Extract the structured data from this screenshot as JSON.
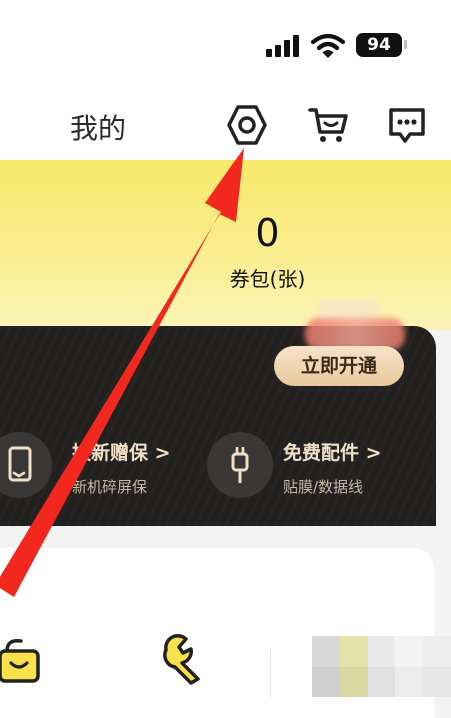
{
  "status_bar": {
    "battery": "94"
  },
  "nav": {
    "title": "我的",
    "icons": [
      "settings-hexagon-icon",
      "cart-icon",
      "message-icon"
    ]
  },
  "coupon": {
    "count": "0",
    "label": "券包(张)"
  },
  "vip": {
    "open_button": "立即开通",
    "benefits": [
      {
        "title": "换新赠保 >",
        "subtitle": "新机碎屏保",
        "icon": "phone-shield-icon"
      },
      {
        "title": "免费配件 >",
        "subtitle": "贴膜/数据线",
        "icon": "usb-cable-icon"
      }
    ]
  },
  "bottom": {
    "icons": [
      "shopping-bag-icon",
      "wrench-icon"
    ]
  },
  "colors": {
    "accent_yellow": "#f8e86a",
    "card_dark": "#232120",
    "gold_text": "#f1dfc7",
    "annotation_red": "#f2281e"
  }
}
